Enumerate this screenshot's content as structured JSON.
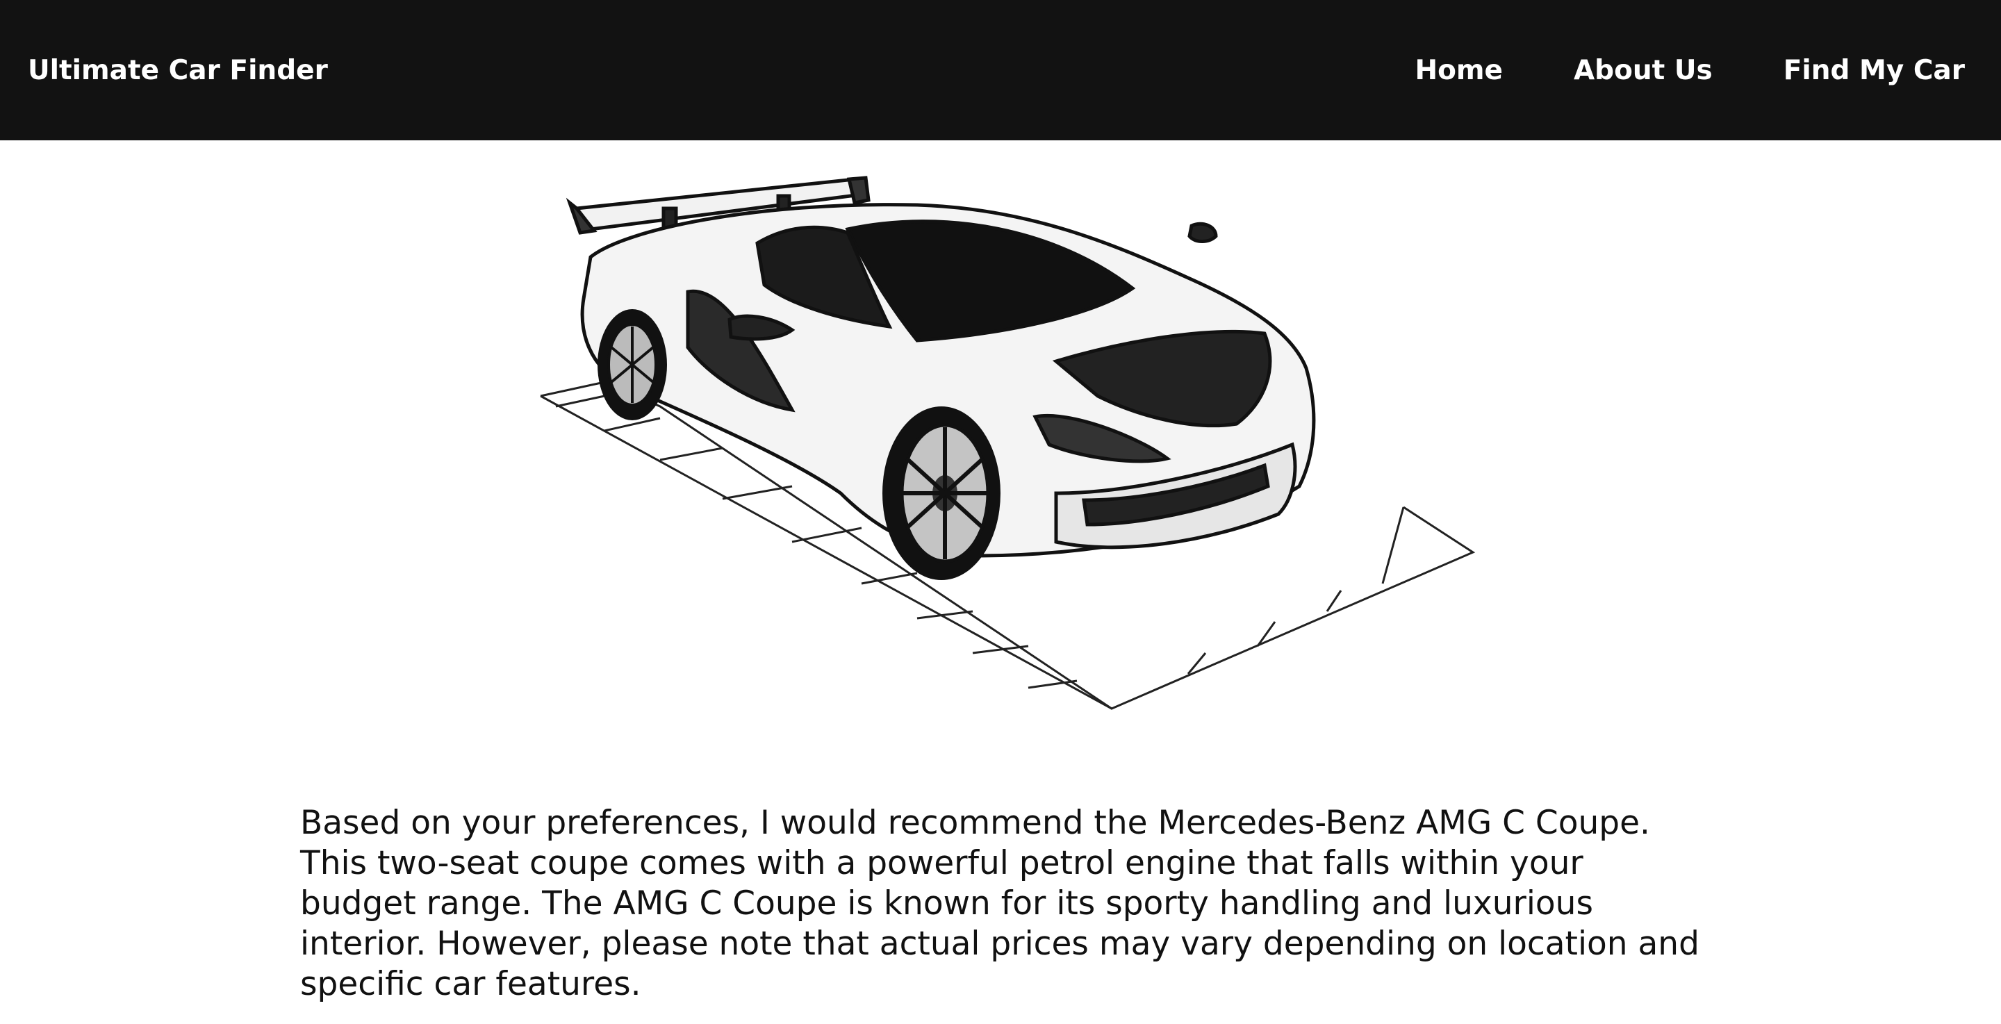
{
  "header": {
    "brand": "Ultimate Car Finder",
    "nav": [
      {
        "label": "Home"
      },
      {
        "label": "About Us"
      },
      {
        "label": "Find My Car"
      }
    ]
  },
  "main": {
    "hero_image": {
      "name": "sports-car-illustration",
      "style": "black-and-white line drawing"
    },
    "recommendation_text": "Based on your preferences, I would recommend the Mercedes-Benz AMG C Coupe. This two-seat coupe comes with a powerful petrol engine that falls within your budget range. The AMG C Coupe is known for its sporty handling and luxurious interior. However, please note that actual prices may vary depending on location and specific car features."
  },
  "colors": {
    "header_bg": "#121212",
    "header_text": "#ffffff",
    "body_text": "#111111",
    "page_bg": "#ffffff"
  }
}
